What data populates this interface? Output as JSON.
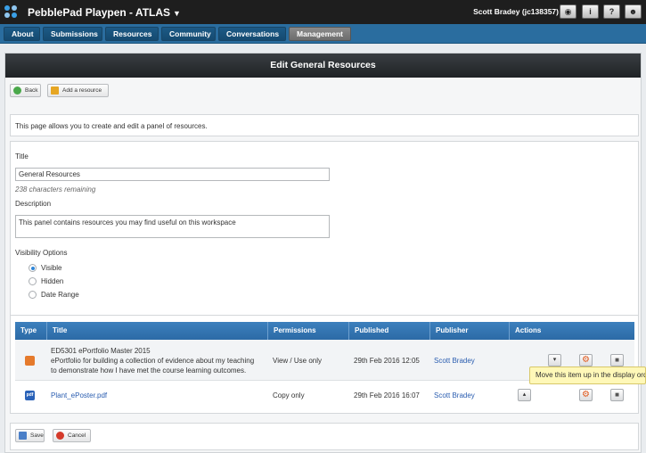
{
  "header": {
    "app_title": "PebblePad Playpen - ATLAS",
    "caret": "▼",
    "user_name": "Scott Bradey (jc138357)",
    "icons": [
      "eye-icon",
      "info-icon",
      "help-icon",
      "user-icon"
    ]
  },
  "nav": {
    "tabs": [
      {
        "label": "About"
      },
      {
        "label": "Submissions"
      },
      {
        "label": "Resources"
      },
      {
        "label": "Community"
      },
      {
        "label": "Conversations"
      },
      {
        "label": "Management"
      }
    ]
  },
  "page": {
    "title": "Edit General Resources",
    "back_label": "Back",
    "add_resource_label": "Add a resource",
    "intro": "This page allows you to create and edit a panel of resources."
  },
  "form": {
    "title_label": "Title",
    "title_value": "General Resources",
    "chars_remaining": "238 characters remaining",
    "description_label": "Description",
    "description_value": "This panel contains resources you may find useful on this workspace",
    "visibility_label": "Visibility Options",
    "visibility_options": [
      {
        "label": "Visible",
        "selected": true
      },
      {
        "label": "Hidden",
        "selected": false
      },
      {
        "label": "Date Range",
        "selected": false
      }
    ]
  },
  "table": {
    "headers": [
      "Type",
      "Title",
      "Permissions",
      "Published",
      "Publisher",
      "Actions"
    ],
    "rows": [
      {
        "type_icon": "portfolio-icon",
        "title": "ED5301 ePortfolio Master 2015",
        "desc_line1": "ePortfolio for building a collection of evidence about my teaching",
        "desc_line2": "to demonstrate how I have met the course learning outcomes.",
        "permissions": "View / Use only",
        "published": "29th Feb 2016 12:05",
        "publisher": "Scott Bradey"
      },
      {
        "type_icon": "pdf-icon",
        "type_text": "pdf",
        "title": "Plant_ePoster.pdf",
        "permissions": "Copy only",
        "published": "29th Feb 2016 16:07",
        "publisher": "Scott Bradey"
      }
    ]
  },
  "tooltip": "Move this item up in the display order",
  "footer": {
    "save_label": "Save",
    "cancel_label": "Cancel"
  }
}
